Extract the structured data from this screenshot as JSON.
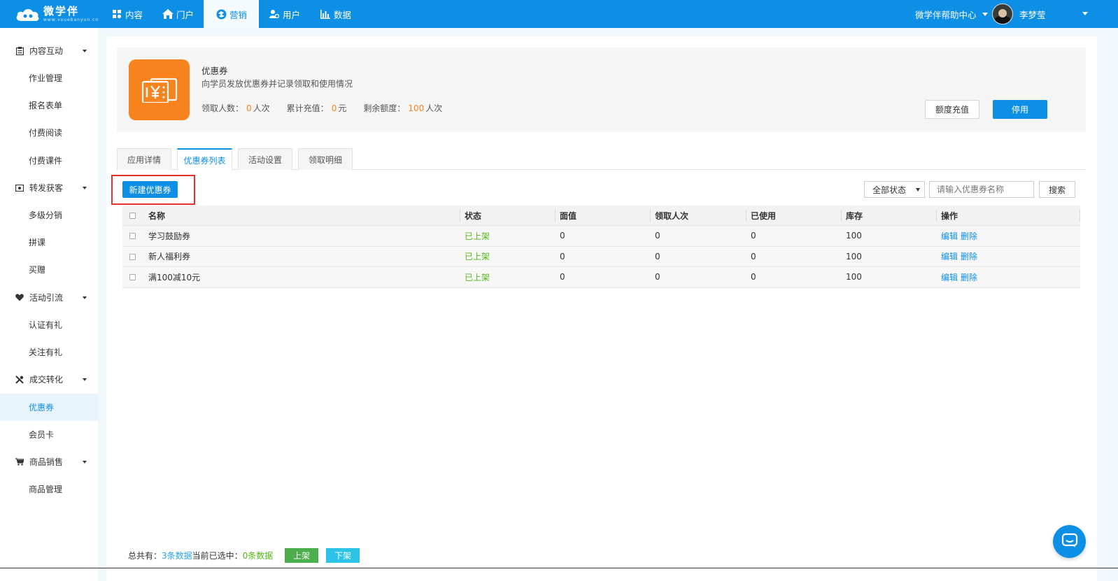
{
  "topbar": {
    "logo": {
      "name": "微学伴",
      "url": "www.vxuebanyun.cn"
    },
    "nav": [
      {
        "label": "内容",
        "icon": "grid-icon"
      },
      {
        "label": "门户",
        "icon": "home-icon"
      },
      {
        "label": "营销",
        "icon": "marketing-icon",
        "active": true
      },
      {
        "label": "用户",
        "icon": "users-icon"
      },
      {
        "label": "数据",
        "icon": "bar-chart-icon"
      }
    ],
    "help_label": "微学伴帮助中心",
    "username": "李梦莹"
  },
  "sidebar": {
    "groups": [
      {
        "label": "内容互动",
        "icon": "clipboard-icon",
        "items": [
          "作业管理",
          "报名表单",
          "付费阅读",
          "付费课件"
        ]
      },
      {
        "label": "转发获客",
        "icon": "share-icon",
        "items": [
          "多级分销",
          "拼课",
          "买赠"
        ]
      },
      {
        "label": "活动引流",
        "icon": "heart-icon",
        "items": [
          "认证有礼",
          "关注有礼"
        ]
      },
      {
        "label": "成交转化",
        "icon": "tools-icon",
        "items": [
          "优惠券",
          "会员卡"
        ],
        "active_item": "优惠券"
      },
      {
        "label": "商品销售",
        "icon": "cart-icon",
        "items": [
          "商品管理"
        ]
      }
    ]
  },
  "app_card": {
    "title": "优惠券",
    "description": "向学员发放优惠券并记录领取和使用情况",
    "stats": [
      {
        "label": "领取人数：",
        "value": "0",
        "unit": "人次"
      },
      {
        "label": "累计充值：",
        "value": "0",
        "unit": "元"
      },
      {
        "label": "剩余额度：",
        "value": "100",
        "unit": "人次"
      }
    ],
    "recharge_label": "额度充值",
    "stop_label": "停用",
    "accent": "#f7831f"
  },
  "tabs": [
    {
      "label": "应用详情"
    },
    {
      "label": "优惠券列表",
      "active": true
    },
    {
      "label": "活动设置"
    },
    {
      "label": "领取明细"
    }
  ],
  "toolbar": {
    "new_label": "新建优惠券",
    "status_select": "全部状态",
    "search_placeholder": "请输入优惠券名称",
    "search_label": "搜索"
  },
  "table": {
    "columns": [
      "名称",
      "状态",
      "面值",
      "领取人次",
      "已使用",
      "库存",
      "操作"
    ],
    "rows": [
      {
        "name": "学习鼓励券",
        "status": "已上架",
        "face": "0",
        "claimed": "0",
        "used": "0",
        "stock": "100",
        "edit": "编辑",
        "del": "删除"
      },
      {
        "name": "新人福利券",
        "status": "已上架",
        "face": "0",
        "claimed": "0",
        "used": "0",
        "stock": "100",
        "edit": "编辑",
        "del": "删除"
      },
      {
        "name": "满100减10元",
        "status": "已上架",
        "face": "0",
        "claimed": "0",
        "used": "0",
        "stock": "100",
        "edit": "编辑",
        "del": "删除"
      }
    ]
  },
  "footer": {
    "total_prefix": "总共有：",
    "total_value": "3条数据",
    "selected_prefix": " 当前已选中：",
    "selected_value": "0条数据",
    "up_label": "上架",
    "down_label": "下架"
  },
  "colors": {
    "primary": "#0e8fe6",
    "status_green": "#52b818",
    "orange": "#f7831f",
    "highlight_red": "#e5312e"
  }
}
